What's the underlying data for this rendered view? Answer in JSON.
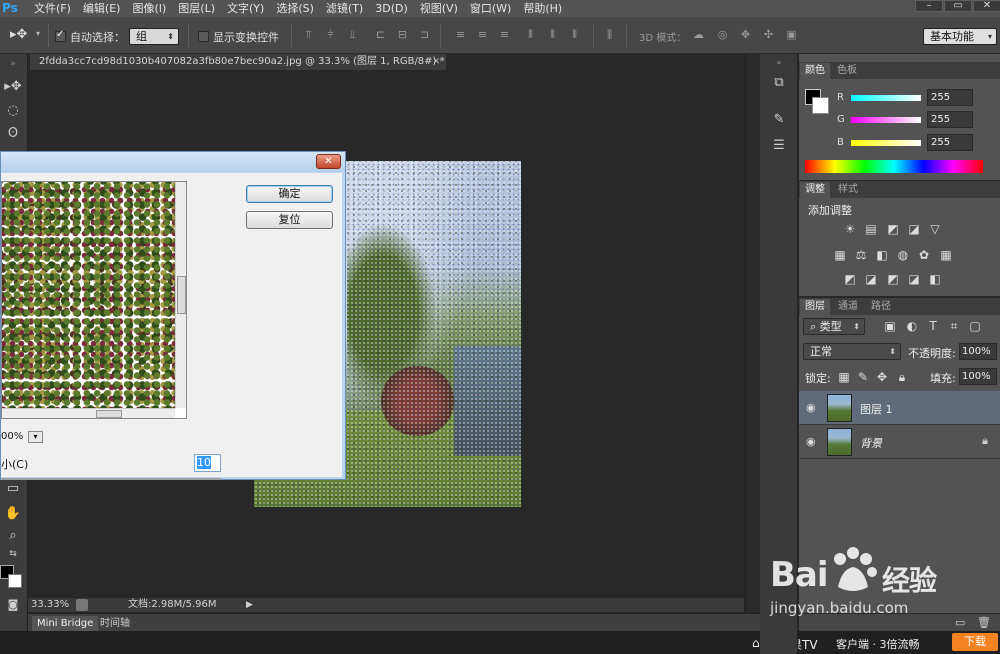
{
  "menubar": {
    "logo": "Ps",
    "items": [
      "文件(F)",
      "编辑(E)",
      "图像(I)",
      "图层(L)",
      "文字(Y)",
      "选择(S)",
      "滤镜(T)",
      "3D(D)",
      "视图(V)",
      "窗口(W)",
      "帮助(H)"
    ]
  },
  "options": {
    "auto_select_label": "自动选择：",
    "auto_select_value": "组",
    "transform_label": "显示变换控件",
    "mode3d_label": "3D 模式：",
    "workspace": "基本功能"
  },
  "document": {
    "tab_title": "2fdda3cc7cd98d1030b407082a3fb80e7bec90a2.jpg @ 33.3% (图层 1, RGB/8#) *",
    "zoom": "33.33%",
    "doc_size": "文档:2.98M/5.96M"
  },
  "bottom_tabs": [
    "Mini Bridge",
    "时间轴"
  ],
  "color_panel": {
    "tabs": [
      "颜色",
      "色板"
    ],
    "r_label": "R",
    "r_value": "255",
    "g_label": "G",
    "g_value": "255",
    "b_label": "B",
    "b_value": "255"
  },
  "adjust_panel": {
    "tabs": [
      "调整",
      "样式"
    ],
    "title": "添加调整"
  },
  "layers_panel": {
    "tabs": [
      "图层",
      "通道",
      "路径"
    ],
    "filter_label": "类型",
    "blend_mode": "正常",
    "opacity_label": "不透明度:",
    "opacity_value": "100%",
    "lock_label": "锁定:",
    "fill_label": "填充:",
    "fill_value": "100%",
    "layers": [
      {
        "name": "图层 1",
        "selected": true
      },
      {
        "name": "背景",
        "selected": false
      }
    ]
  },
  "dialog": {
    "ok_label": "确定",
    "reset_label": "复位",
    "zoom_value": "00%",
    "cell_label": "小(C)",
    "cell_value": "10"
  },
  "watermark": {
    "brand": "Bai",
    "brand2": "经验",
    "url": "jingyan.baidu.com"
  },
  "footer": {
    "text_left": "芒果TV",
    "text_mid": "客户端 · 3倍流畅",
    "download": "下载"
  }
}
